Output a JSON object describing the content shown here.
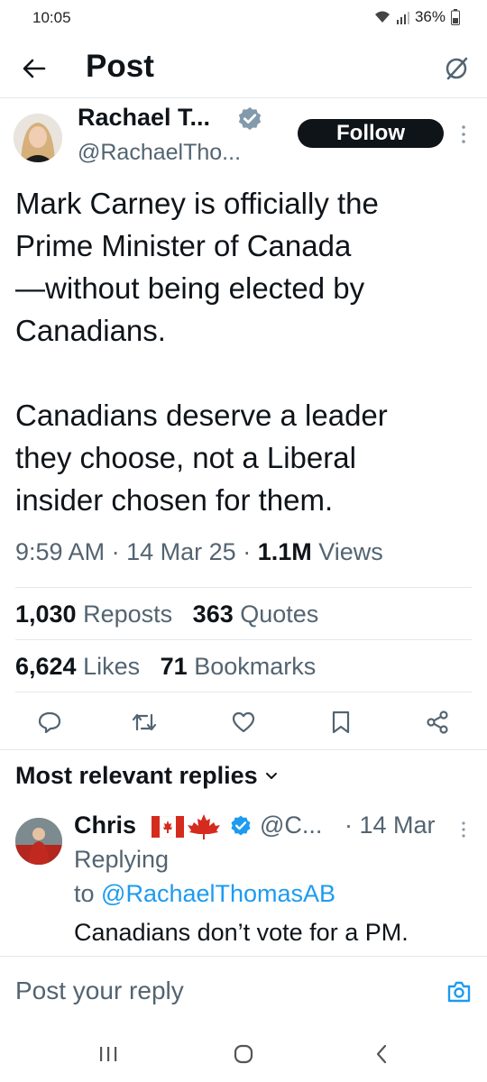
{
  "status_bar": {
    "time": "10:05",
    "battery": "36%"
  },
  "header": {
    "title": "Post"
  },
  "author": {
    "name": "Rachael T...",
    "handle": "@RachaelTho..."
  },
  "follow_label": "Follow",
  "tweet": {
    "text": "Mark Carney is officially the\nPrime Minister of Canada\n—without being elected by\nCanadians.\n\nCanadians deserve a leader\nthey  choose, not a Liberal\ninsider chosen for them.",
    "time": "9:59 AM",
    "date": "14 Mar 25",
    "views_count": "1.1M",
    "views_label": "Views",
    "separator": "·"
  },
  "stats": {
    "reposts": {
      "count": "1,030",
      "label": "Reposts"
    },
    "quotes": {
      "count": "363",
      "label": "Quotes"
    },
    "likes": {
      "count": "6,624",
      "label": "Likes"
    },
    "bookmarks": {
      "count": "71",
      "label": "Bookmarks"
    }
  },
  "replies_section": {
    "title": "Most relevant replies"
  },
  "reply": {
    "name": "Chris",
    "handle": "@C...",
    "date": "· 14 Mar",
    "replying_prefix": "Replying",
    "replying_to": "to",
    "mention": "@RachaelThomasAB",
    "text": "Canadians don’t vote for a PM."
  },
  "compose": {
    "placeholder": "Post your reply"
  },
  "icons": {
    "back": "arrow-left-icon",
    "grok": "grok-icon",
    "verified": "verified-badge-icon",
    "more": "more-vertical-icon",
    "reply": "reply-icon",
    "repost": "repost-icon",
    "like": "heart-icon",
    "bookmark": "bookmark-icon",
    "share": "share-icon",
    "camera": "camera-icon",
    "chevron": "chevron-down-icon"
  },
  "colors": {
    "accent": "#1d9bf0",
    "text": "#0f1419",
    "secondary": "#536471",
    "follow_bg": "#0f1419"
  }
}
